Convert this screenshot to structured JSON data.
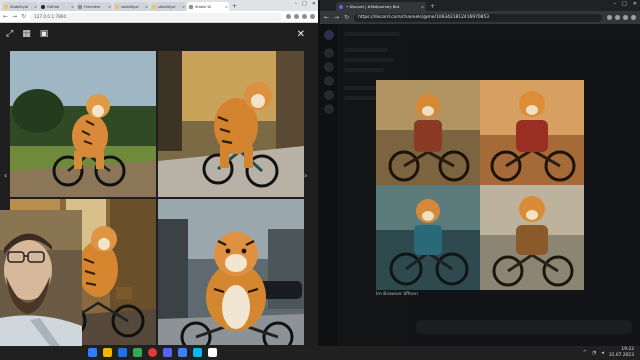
{
  "left_browser": {
    "tabs": [
      {
        "label": "StabilityAI",
        "icon": "hf"
      },
      {
        "label": "GitHub",
        "icon": "gh"
      },
      {
        "label": "Freeview",
        "icon": "generic"
      },
      {
        "label": "stabilityai",
        "icon": "hf"
      },
      {
        "label": "stabilityai",
        "icon": "hf"
      },
      {
        "label": "Stable Di",
        "icon": "generic",
        "active": true
      }
    ],
    "new_tab": "+",
    "url": "127.0.0.1:7860"
  },
  "gallery": {
    "tool_icons": [
      "expand-icon",
      "grid-icon",
      "save-icon"
    ],
    "close": "✕",
    "prev": "‹",
    "next": "›",
    "images": [
      "tiger-riding-bicycle-on-grass",
      "tiger-riding-bicycle-on-street",
      "tiger-with-bicycle-in-alley",
      "tiger-on-bicycle-in-city"
    ]
  },
  "right_browser": {
    "tab_title": "• Discord | #Midjourney Bot",
    "new_tab": "+",
    "url": "https://discord.com/channels/@me/1063421812416970853"
  },
  "discord": {
    "midjourney_grid": [
      "tiger-rider-motorcycle-1",
      "tiger-rider-motorcycle-2",
      "tiger-rider-bicycle-3",
      "tiger-rider-bicycle-4"
    ],
    "caption": "Im Browser öffnen"
  },
  "taskbar": {
    "time": "19:22",
    "date": "31.07.2023",
    "apps": [
      "#2d7ff9",
      "#f4b400",
      "#1a73e8",
      "#34a853",
      "#e53935",
      "#5865f2",
      "#3b82f6",
      "#0db7ed",
      "#ffffff"
    ]
  },
  "colors": {
    "discord_bg": "#17181b",
    "gallery_bg": "#1f1f1f",
    "taskbar": "#202020"
  }
}
